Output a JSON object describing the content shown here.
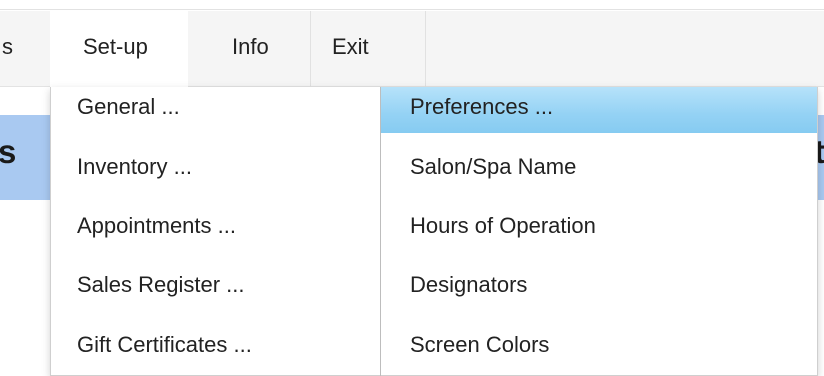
{
  "menubar": {
    "items": [
      {
        "label": "s"
      },
      {
        "label": "Set-up",
        "active": true
      },
      {
        "label": "Info"
      },
      {
        "label": "Exit"
      }
    ]
  },
  "background": {
    "left_text": "s",
    "right_text": "t",
    "band_color": "#a9c9f1"
  },
  "setup_menu": {
    "left": [
      {
        "label": "General ..."
      },
      {
        "label": "Inventory ..."
      },
      {
        "label": "Appointments ..."
      },
      {
        "label": "Sales Register ..."
      },
      {
        "label": "Gift Certificates ..."
      }
    ],
    "right": [
      {
        "label": "Preferences ...",
        "highlighted": true
      },
      {
        "label": "Salon/Spa Name"
      },
      {
        "label": "Hours of Operation"
      },
      {
        "label": "Designators"
      },
      {
        "label": "Screen Colors"
      }
    ],
    "highlight_color": "#94d2f4"
  }
}
